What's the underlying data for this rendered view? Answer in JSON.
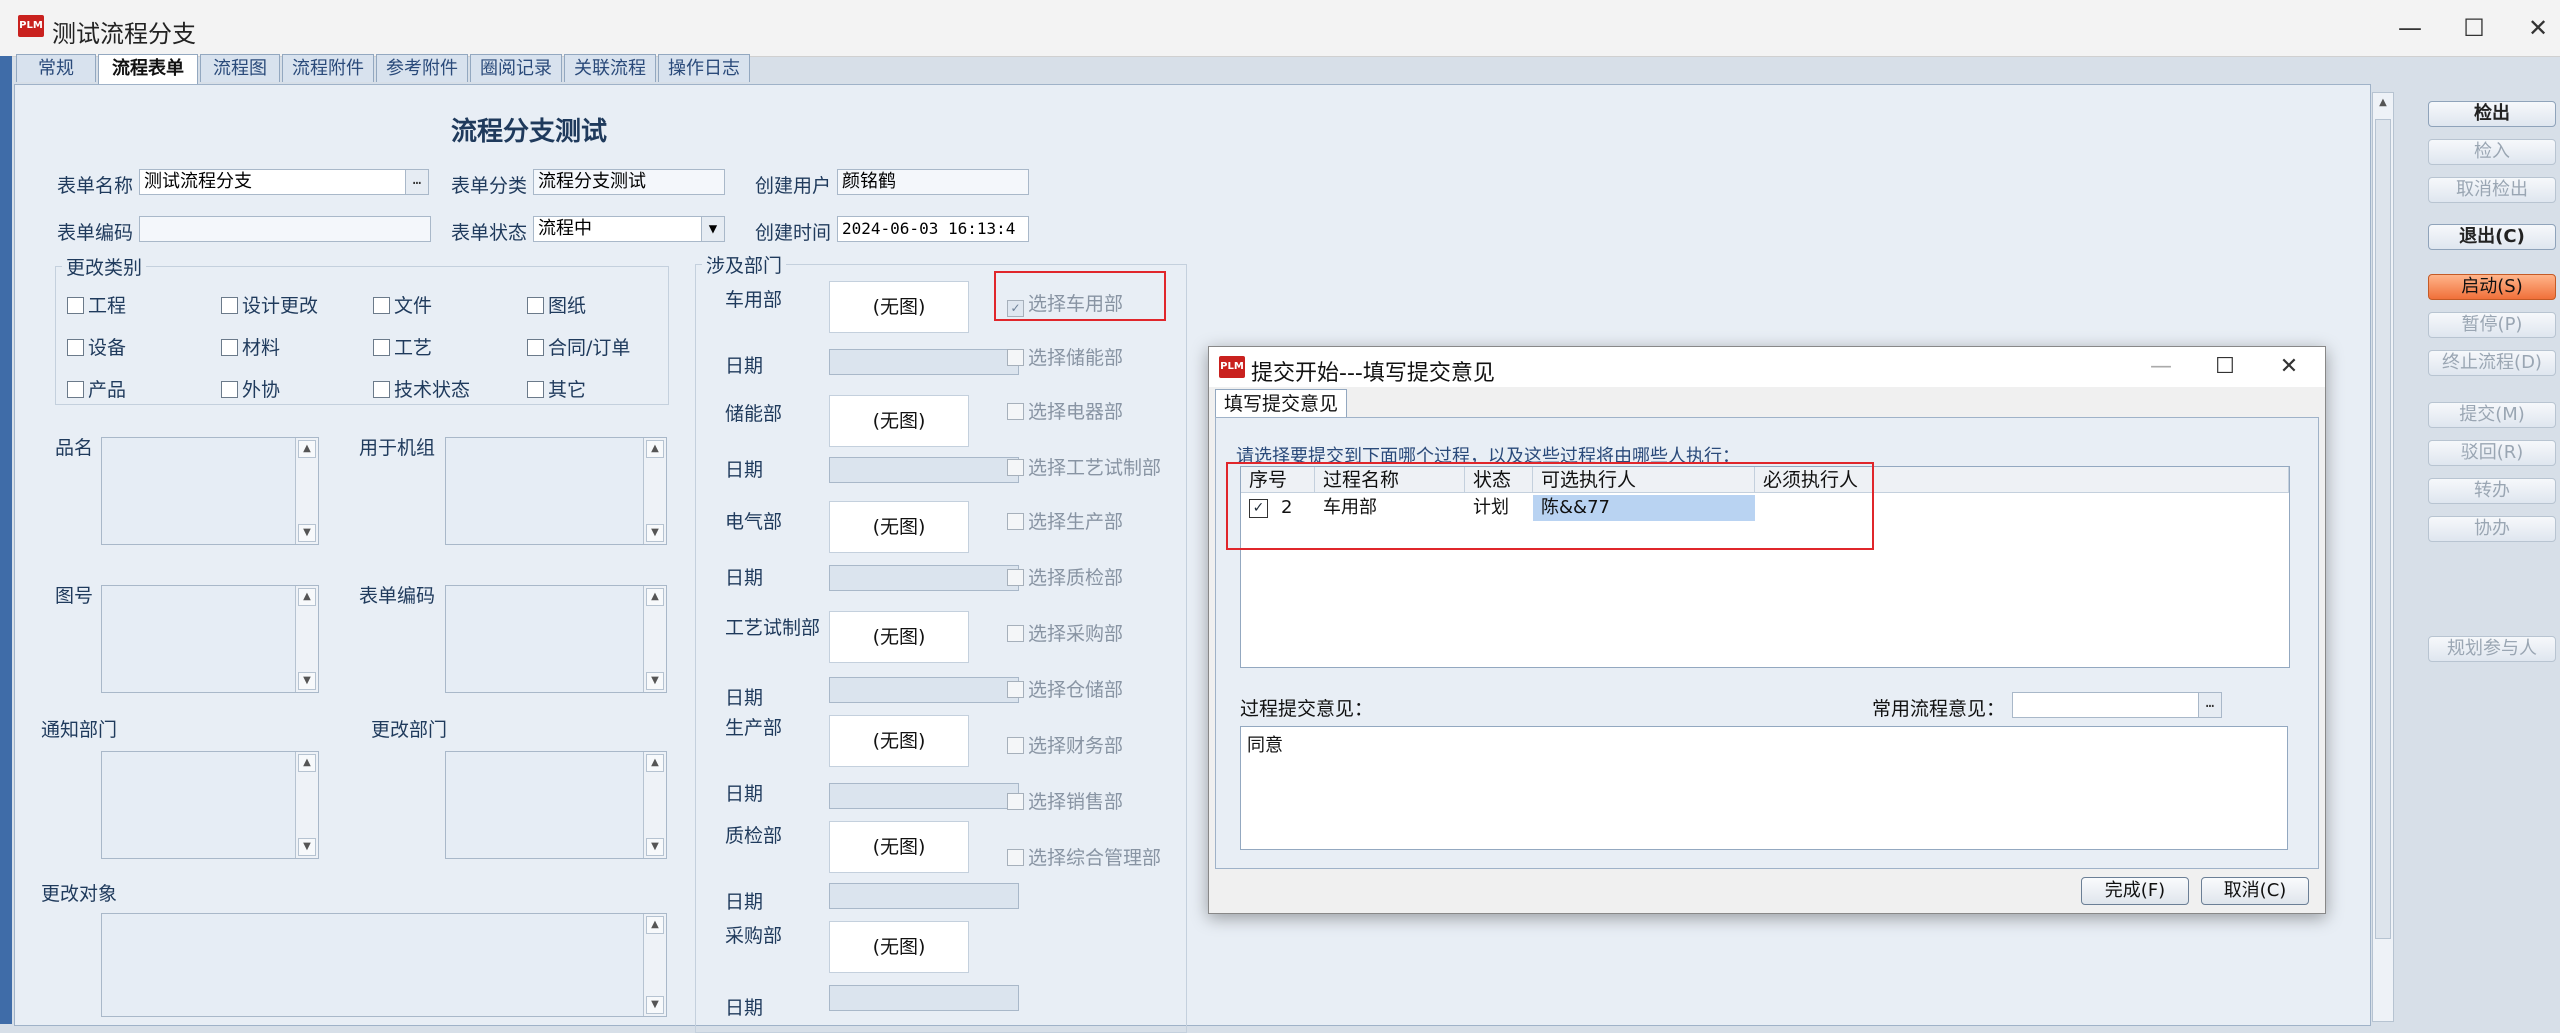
{
  "window": {
    "title": "测试流程分支",
    "app_icon": "PLM"
  },
  "tabs": [
    "常规",
    "流程表单",
    "流程图",
    "流程附件",
    "参考附件",
    "圈阅记录",
    "关联流程",
    "操作日志"
  ],
  "form": {
    "heading": "流程分支测试",
    "form_name_label": "表单名称",
    "form_name_value": "测试流程分支",
    "form_category_label": "表单分类",
    "form_category_value": "流程分支测试",
    "creator_label": "创建用户",
    "creator_value": "颜铭鹤",
    "form_code_label": "表单编码",
    "form_code_value": "",
    "form_status_label": "表单状态",
    "form_status_value": "流程中",
    "created_time_label": "创建时间",
    "created_time_value": "2024-06-03 16:13:4",
    "change_type_legend": "更改类别",
    "change_types": [
      "工程",
      "设计更改",
      "文件",
      "图纸",
      "设备",
      "材料",
      "工艺",
      "合同/订单",
      "产品",
      "外协",
      "技术状态",
      "其它"
    ],
    "product_name_label": "品名",
    "machine_group_label": "用于机组",
    "drawing_no_label": "图号",
    "form_code2_label": "表单编码",
    "notify_dept_label": "通知部门",
    "change_dept_label": "更改部门",
    "change_object_label": "更改对象",
    "dept_legend": "涉及部门",
    "departments": [
      {
        "name": "车用部",
        "image": "(无图)",
        "date_label": "日期",
        "check": "选择车用部",
        "checked": true
      },
      {
        "name": "储能部",
        "image": "(无图)",
        "date_label": "日期",
        "check": "选择储能部",
        "checked": false
      },
      {
        "name": "电气部",
        "image": "(无图)",
        "date_label": "日期",
        "check": "选择电器部",
        "checked": false
      },
      {
        "name": "工艺试制部",
        "image": "(无图)",
        "date_label": "日期",
        "check": "选择工艺试制部",
        "checked": false
      },
      {
        "name": "生产部",
        "image": "(无图)",
        "date_label": "日期",
        "check": "选择生产部",
        "checked": false
      },
      {
        "name": "质检部",
        "image": "(无图)",
        "date_label": "日期",
        "check": "选择质检部",
        "checked": false
      },
      {
        "name": "采购部",
        "image": "(无图)",
        "date_label": "日期",
        "check": "选择采购部",
        "checked": false
      }
    ],
    "extra_checks": [
      "选择仓储部",
      "选择财务部",
      "选择销售部",
      "选择综合管理部"
    ]
  },
  "side_buttons": {
    "checkout": "检出",
    "checkin": "检入",
    "cancel_checkout": "取消检出",
    "exit": "退出(C)",
    "start": "启动(S)",
    "pause": "暂停(P)",
    "terminate": "终止流程(D)",
    "submit": "提交(M)",
    "reject": "驳回(R)",
    "transfer": "转办",
    "assist": "协办",
    "plan_participants": "规划参与人"
  },
  "dialog": {
    "title": "提交开始---填写提交意见",
    "tab": "填写提交意见",
    "prompt": "请选择要提交到下面哪个过程，以及这些过程将由哪些人执行：",
    "columns": [
      "序号",
      "过程名称",
      "状态",
      "可选执行人",
      "必须执行人"
    ],
    "rows": [
      {
        "checked": true,
        "seq": "2",
        "process": "车用部",
        "status": "计划",
        "optional": "陈&&77",
        "required": ""
      }
    ],
    "opinion_label": "过程提交意见：",
    "common_opinion_label": "常用流程意见：",
    "opinion_text": "同意",
    "finish": "完成(F)",
    "cancel": "取消(C)"
  },
  "colors": {
    "accent_orange": "#f0703a",
    "highlight_red": "#e0262b",
    "selected_cell": "#b9d3f2"
  }
}
